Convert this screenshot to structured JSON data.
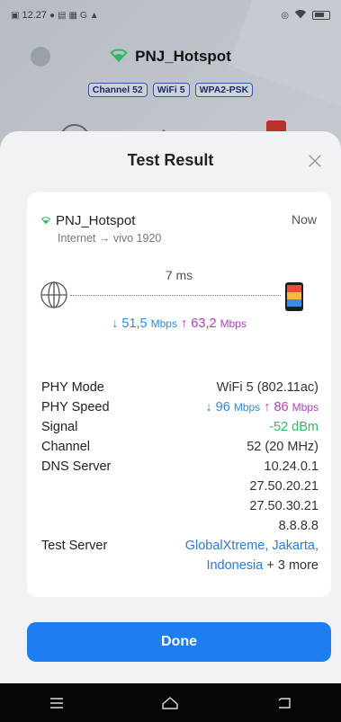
{
  "status_bar": {
    "time": "12.27",
    "notification_icons": [
      "message-icon",
      "wifi-test-icon",
      "mail-icon",
      "image-icon",
      "google-icon",
      "tapo-icon"
    ],
    "right_icons": [
      "location-icon",
      "wifi-icon",
      "battery-icon"
    ]
  },
  "background": {
    "ssid": "PNJ_Hotspot",
    "badges": [
      "Channel 52",
      "WiFi 5",
      "WPA2-PSK"
    ]
  },
  "sheet": {
    "title": "Test Result",
    "close_icon": "close-icon"
  },
  "result": {
    "network_name": "PNJ_Hotspot",
    "network_sub": "Internet → vivo 1920",
    "time": "Now",
    "latency": "7 ms",
    "download_value": "51,5",
    "download_unit": "Mbps",
    "upload_value": "63,2",
    "upload_unit": "Mbps"
  },
  "details": {
    "phy_mode": {
      "label": "PHY Mode",
      "value": "WiFi 5 (802.11ac)"
    },
    "phy_speed": {
      "label": "PHY Speed",
      "down_value": "96",
      "down_unit": "Mbps",
      "up_value": "86",
      "up_unit": "Mbps"
    },
    "signal": {
      "label": "Signal",
      "value": "-52 dBm"
    },
    "channel": {
      "label": "Channel",
      "value": "52 (20 MHz)"
    },
    "dns": {
      "label": "DNS Server",
      "values": [
        "10.24.0.1",
        "27.50.20.21",
        "27.50.30.21",
        "8.8.8.8"
      ]
    },
    "test_server": {
      "label": "Test Server",
      "link_line1": "GlobalXtreme, Jakarta,",
      "link_line2": "Indonesia",
      "suffix": "+ 3 more"
    }
  },
  "done_label": "Done",
  "colors": {
    "accent": "#1e7df0",
    "download": "#2a8be0",
    "upload": "#b23fbf",
    "signal_good": "#2fb866",
    "wifi_green": "#2fb866"
  }
}
